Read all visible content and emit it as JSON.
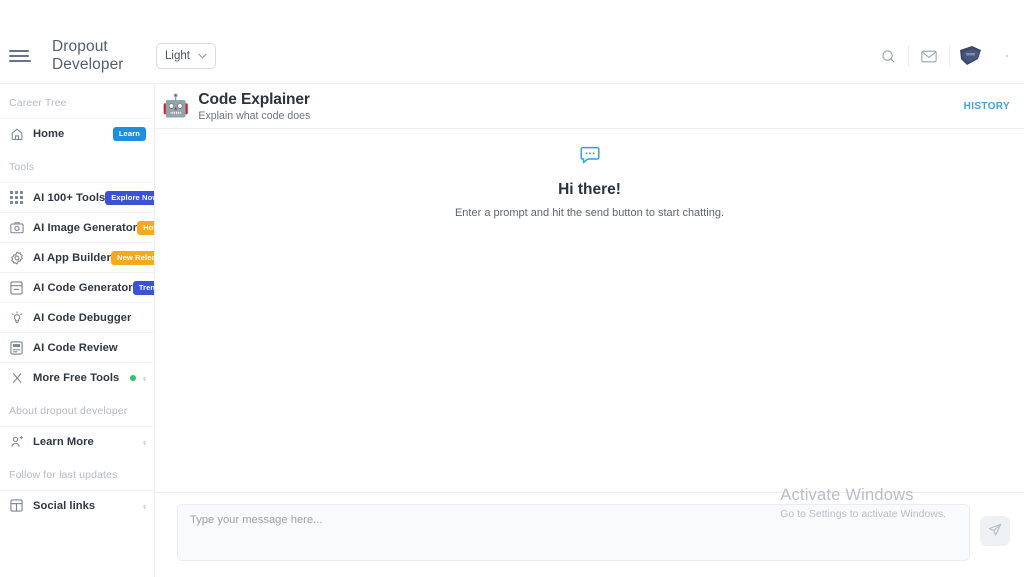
{
  "topbar": {
    "menu_icon": "hamburger-icon",
    "brand_line1": "Dropout",
    "brand_line2": "Developer",
    "theme_value": "Light",
    "theme_chevron": "▾",
    "search_icon": "search-icon",
    "mail_icon": "mail-icon",
    "avatar_icon": "badge-avatar-icon"
  },
  "sidebar": {
    "sections": [
      {
        "label": "Career Tree"
      },
      {
        "label": "Tools"
      },
      {
        "label": "About dropout developer"
      },
      {
        "label": "Follow for last updates"
      }
    ],
    "career_items": [
      {
        "label": "Home",
        "icon": "home-icon",
        "badge": "Learn",
        "badge_color": "#1d8fe0"
      }
    ],
    "tools_items": [
      {
        "label": "AI 100+ Tools",
        "icon": "grid-icon",
        "badge": "Explore Now",
        "badge_color": "#3a52d6"
      },
      {
        "label": "AI Image Generator",
        "icon": "image-icon",
        "badge": "Hot",
        "badge_color": "#f6a821"
      },
      {
        "label": "AI App Builder",
        "icon": "gear-icon",
        "badge": "New Release",
        "badge_color": "#f6a821"
      },
      {
        "label": "AI Code Generator",
        "icon": "document-icon",
        "badge": "Trending",
        "badge_color": "#3a52d6"
      },
      {
        "label": "AI Code Debugger",
        "icon": "bug-lightbulb-icon",
        "badge": ""
      },
      {
        "label": "AI Code Review",
        "icon": "review-icon",
        "badge": ""
      },
      {
        "label": "More Free Tools",
        "icon": "scissors-icon",
        "badge": "",
        "status_dot": "#2bc46b",
        "chevron": "‹"
      }
    ],
    "about_items": [
      {
        "label": "Learn More",
        "icon": "user-add-icon",
        "chevron": "‹"
      }
    ],
    "follow_items": [
      {
        "label": "Social links",
        "icon": "layout-icon",
        "chevron": "‹"
      }
    ]
  },
  "main": {
    "header": {
      "icon": "robot-icon",
      "emoji": "🤖",
      "title": "Code Explainer",
      "subtitle": "Explain what code does",
      "history_label": "HISTORY"
    },
    "empty_state": {
      "icon": "chat-bubble-icon",
      "title": "Hi there!",
      "message": "Enter a prompt and hit the send button to start chatting."
    },
    "composer": {
      "placeholder": "Type your message here...",
      "value": "",
      "send_icon": "send-icon"
    }
  },
  "watermark": {
    "line1": "Activate Windows",
    "line2": "Go to Settings to activate Windows."
  }
}
